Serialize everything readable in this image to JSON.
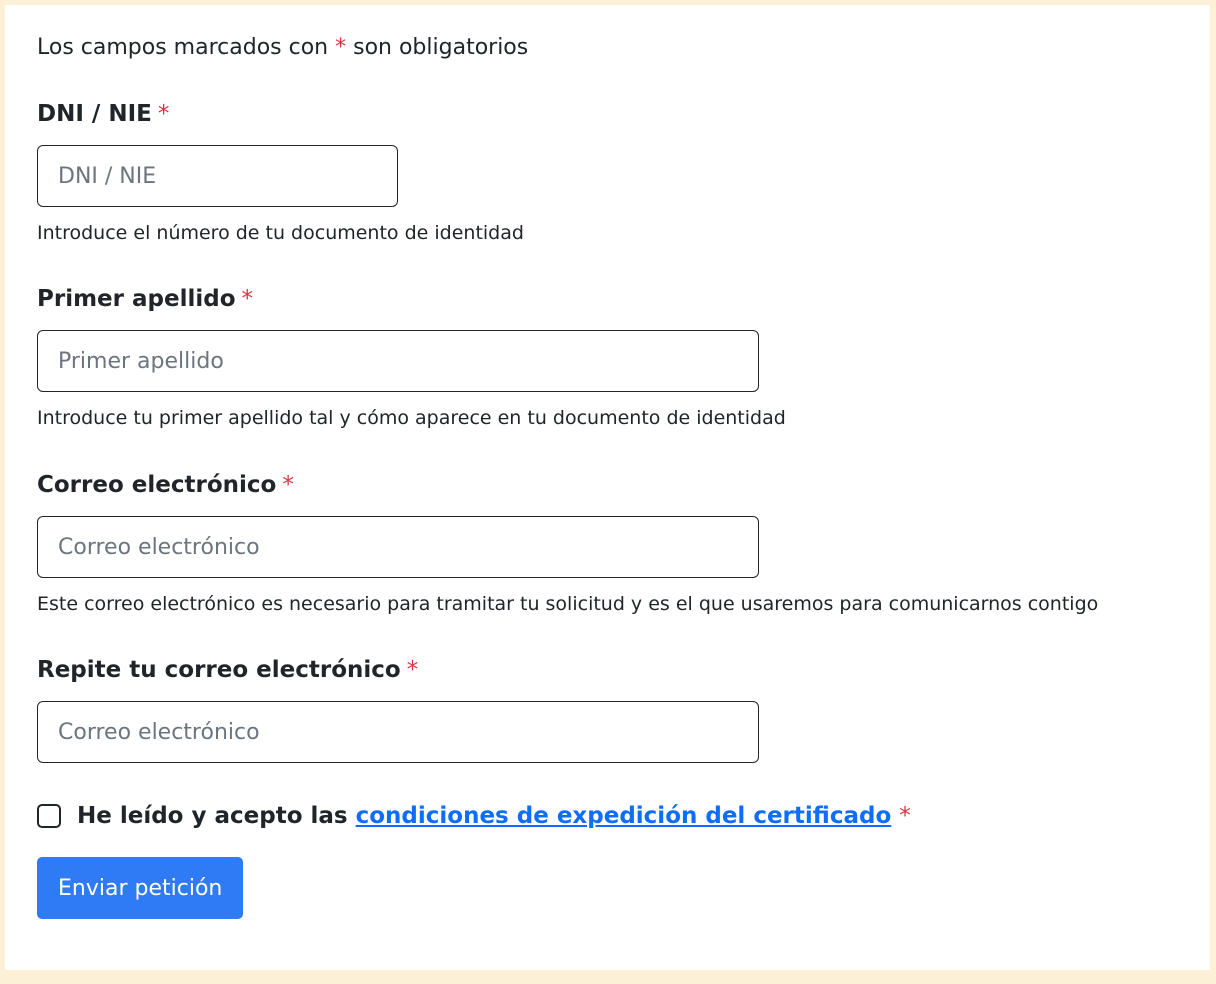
{
  "form": {
    "required_note": {
      "prefix": "Los campos marcados con",
      "asterisk": "*",
      "suffix": "son obligatorios"
    },
    "fields": [
      {
        "label": "DNI / NIE",
        "required_mark": "*",
        "placeholder": "DNI / NIE",
        "value": "",
        "help": "Introduce el número de tu documento de identidad"
      },
      {
        "label": "Primer apellido",
        "required_mark": "*",
        "placeholder": "Primer apellido",
        "value": "",
        "help": "Introduce tu primer apellido tal y cómo aparece en tu documento de identidad"
      },
      {
        "label": "Correo electrónico",
        "required_mark": "*",
        "placeholder": "Correo electrónico",
        "value": "",
        "help": "Este correo electrónico es necesario para tramitar tu solicitud y es el que usaremos para comunicarnos contigo"
      },
      {
        "label": "Repite tu correo electrónico",
        "required_mark": "*",
        "placeholder": "Correo electrónico",
        "value": ""
      }
    ],
    "terms": {
      "checked": false,
      "label": "He leído y acepto las",
      "link_text": "condiciones de expedición del certificado",
      "required_mark": "*"
    },
    "submit_label": "Enviar petición"
  },
  "colors": {
    "page_border": "#fcf0d6",
    "required": "#dc3545",
    "link": "#0d6efd",
    "primary_button": "#2f7bf6"
  }
}
